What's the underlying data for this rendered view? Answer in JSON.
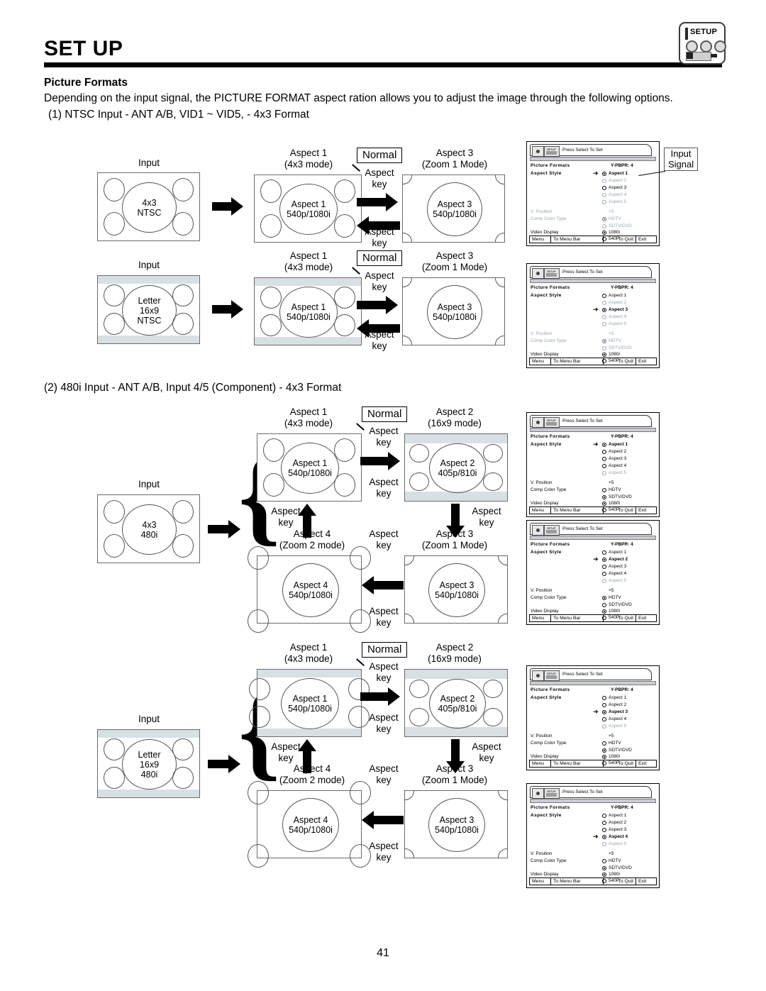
{
  "header": {
    "title": "SET UP",
    "badge": {
      "label": "SETUP",
      "icon": "setup-icon"
    }
  },
  "intro": {
    "subtitle": "Picture Formats",
    "description": "Depending on the input signal, the PICTURE FORMAT aspect ration allows you to adjust the image through the following options.",
    "section1": "(1)  NTSC Input - ANT A/B, VID1 ~ VID5, - 4x3 Format",
    "section2": "(2)  480i Input - ANT A/B, Input 4/5 (Component) - 4x3 Format"
  },
  "labels": {
    "input": "Input",
    "normal": "Normal",
    "aspect_key": "Aspect\nkey",
    "aspect_key_line1": "Aspect",
    "aspect_key_line2": "key",
    "signal_callout_line1": "Input",
    "signal_callout_line2": "Signal"
  },
  "captions": {
    "aspect1": "Aspect 1",
    "aspect1_mode": "(4x3 mode)",
    "aspect2": "Aspect 2",
    "aspect2_mode": "(16x9 mode)",
    "aspect3": "Aspect 3",
    "aspect3_mode": "(Zoom 1 Mode)",
    "aspect4": "Aspect 4",
    "aspect4_mode": "(Zoom 2 mode)"
  },
  "screens": {
    "in_4x3_ntsc_l1": "4x3",
    "in_4x3_ntsc_l2": "NTSC",
    "in_letter_ntsc_l1": "Letter",
    "in_letter_ntsc_l2": "16x9",
    "in_letter_ntsc_l3": "NTSC",
    "in_4x3_480i_l1": "4x3",
    "in_4x3_480i_l2": "480i",
    "in_letter_480i_l1": "Letter",
    "in_letter_480i_l2": "16x9",
    "in_letter_480i_l3": "480i",
    "a1_l1": "Aspect 1",
    "a1_l2": "540p/1080i",
    "a2_l1": "Aspect 2",
    "a2_l2": "405p/810i",
    "a3_l1": "Aspect 3",
    "a3_l2": "540p/1080i",
    "a4_l1": "Aspect 4",
    "a4_l2": "540p/1080i"
  },
  "osd_common": {
    "tab_text": "Press Select To Set",
    "title": "Picture Formats",
    "signal": "Y-PBPR: 4",
    "aspect_style": "Aspect Style",
    "v_position": "V. Position",
    "v_position_value": "+5",
    "comp_color_type": "Comp Color Type",
    "video_display": "Video Display",
    "opt_aspect1": "Aspect 1",
    "opt_aspect2": "Aspect 2",
    "opt_aspect3": "Aspect 3",
    "opt_aspect4": "Aspect 4",
    "opt_aspect5": "Aspect 5",
    "opt_hdtv": "HDTV",
    "opt_sdtv": "SDTV/DVD",
    "opt_1080i": "1080i",
    "opt_540p": "540P",
    "footer": {
      "menu": "Menu",
      "menubar": "To Menu Bar",
      "quit": "To Quit",
      "exit": "Exit"
    }
  },
  "osd_panels": [
    {
      "id": "osd-panel-1",
      "selected": "Aspect 1",
      "aspect_states": [
        "on",
        "dim",
        "off",
        "dim",
        "dim"
      ],
      "color_type": {
        "hdtv": "greyon",
        "sdtv": "dimoff",
        "dimmed": true
      },
      "video": {
        "i1080": "on",
        "p540": "off"
      },
      "v_position_dim": true
    },
    {
      "id": "osd-panel-2",
      "selected": "Aspect 3",
      "aspect_states": [
        "off",
        "dim",
        "on",
        "dim",
        "dim"
      ],
      "color_type": {
        "hdtv": "greyon",
        "sdtv": "dimoff",
        "dimmed": true
      },
      "video": {
        "i1080": "on",
        "p540": "off"
      },
      "v_position_dim": true
    },
    {
      "id": "osd-panel-3",
      "selected": "Aspect 1",
      "aspect_states": [
        "on",
        "off",
        "off",
        "off",
        "dim"
      ],
      "color_type": {
        "hdtv": "off",
        "sdtv": "on",
        "dimmed": false
      },
      "video": {
        "i1080": "on",
        "p540": "off"
      },
      "v_position_dim": false
    },
    {
      "id": "osd-panel-4",
      "selected": "Aspect 2",
      "aspect_states": [
        "off",
        "on",
        "off",
        "off",
        "dim"
      ],
      "color_type": {
        "hdtv": "on",
        "sdtv": "off",
        "dimmed": false
      },
      "video": {
        "i1080": "on",
        "p540": "off"
      },
      "v_position_dim": false
    },
    {
      "id": "osd-panel-5",
      "selected": "Aspect 3",
      "aspect_states": [
        "off",
        "off",
        "on",
        "off",
        "dim"
      ],
      "color_type": {
        "hdtv": "off",
        "sdtv": "on",
        "dimmed": false
      },
      "video": {
        "i1080": "on",
        "p540": "off"
      },
      "v_position_dim": false
    },
    {
      "id": "osd-panel-6",
      "selected": "Aspect 4",
      "aspect_states": [
        "off",
        "off",
        "off",
        "on",
        "dim"
      ],
      "color_type": {
        "hdtv": "off",
        "sdtv": "on",
        "dimmed": false
      },
      "video": {
        "i1080": "on",
        "p540": "off"
      },
      "v_position_dim": false
    }
  ],
  "footer": {
    "page_number": "41"
  },
  "colors": {
    "band": "#d7e0e3",
    "rule": "#000000",
    "dim_text": "#9aa7b0"
  }
}
